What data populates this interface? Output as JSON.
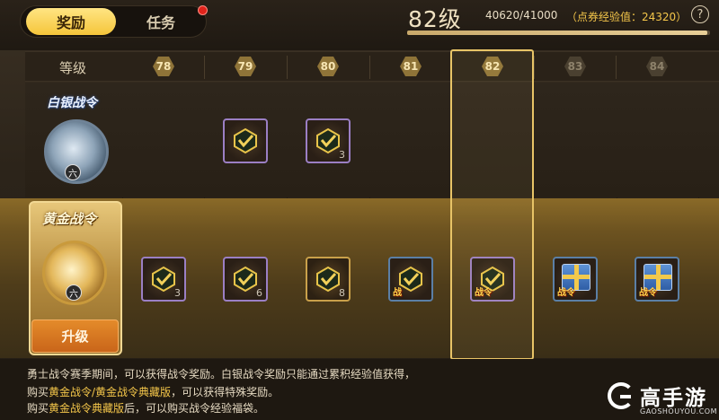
{
  "tabs": [
    {
      "label": "奖励",
      "active": true
    },
    {
      "label": "任务",
      "active": false,
      "has_notification": true
    }
  ],
  "progress": {
    "current_level": "82级",
    "exp_text": "40620/41000",
    "points_text": "（点券经验值：24320）",
    "exp_fraction": 0.99
  },
  "level_row": {
    "header_label": "等级",
    "levels": [
      "78",
      "79",
      "80",
      "81",
      "82",
      "83",
      "84"
    ],
    "current": "82"
  },
  "silver": {
    "label": "白银战令",
    "emblem_number": "六",
    "rewards": [
      {
        "level": "79",
        "icon": "check-badge-icon",
        "count": ""
      },
      {
        "level": "80",
        "icon": "check-badge-icon",
        "count": "3"
      }
    ]
  },
  "gold": {
    "label": "黄金战令",
    "emblem_number": "六",
    "upgrade_label": "升级",
    "rewards": [
      {
        "level": "78",
        "icon": "check-badge-icon",
        "count": "3",
        "tag": ""
      },
      {
        "level": "79",
        "icon": "check-badge-icon",
        "count": "6",
        "tag": ""
      },
      {
        "level": "80",
        "icon": "check-badge-icon",
        "count": "8",
        "tag": ""
      },
      {
        "level": "81",
        "icon": "check-badge-icon",
        "count": "",
        "tag": "战"
      },
      {
        "level": "82",
        "icon": "check-badge-icon",
        "count": "",
        "tag": "战令"
      },
      {
        "level": "83",
        "icon": "gift-box-icon",
        "count": "",
        "tag": "战令"
      },
      {
        "level": "84",
        "icon": "gift-box-icon",
        "count": "",
        "tag": "战令"
      }
    ]
  },
  "notes": {
    "line1": "勇士战令赛季期间，可以获得战令奖励。白银战令奖励只能通过累积经验值获得，",
    "line2_pre": "购买",
    "line2_hl": "黄金战令/黄金战令典藏版",
    "line2_post": "，可以获得特殊奖励。",
    "line3_pre": "购买",
    "line3_hl": "黄金战令典藏版",
    "line3_post": "后，可以购买战令经验福袋。"
  },
  "watermark": {
    "name": "高手游",
    "url": "GAOSHOUYOU.COM"
  },
  "colors": {
    "accent_gold": "#f4c64a",
    "tab_active": "#f5c53a",
    "upgrade_button": "#d9731f"
  }
}
